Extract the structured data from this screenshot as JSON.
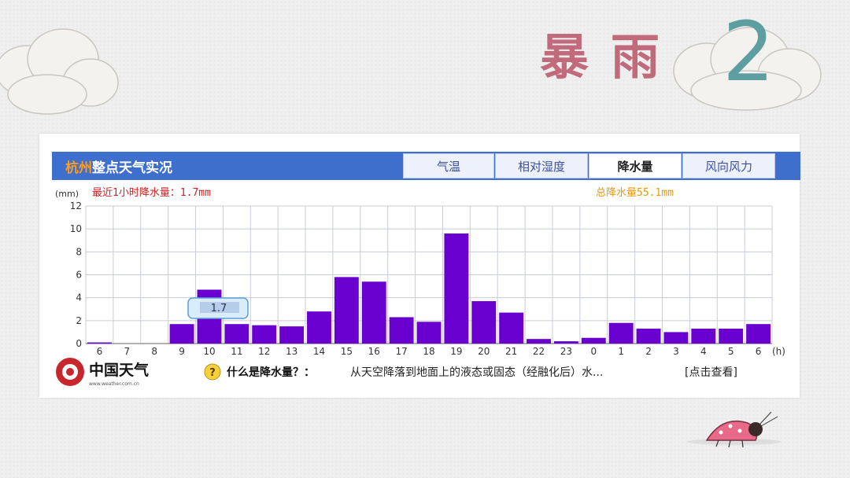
{
  "slide": {
    "title": "暴雨",
    "number": "2"
  },
  "widget": {
    "city": "杭州",
    "title_rest": "整点天气实况",
    "tabs": [
      {
        "label": "气温",
        "active": false
      },
      {
        "label": "相对湿度",
        "active": false
      },
      {
        "label": "降水量",
        "active": true
      },
      {
        "label": "风向风力",
        "active": false
      }
    ],
    "recent_precip_text": "最近1小时降水量：1.7mm",
    "total_precip_text": "总降水量55.1mm",
    "tooltip_value": "1.7",
    "logo_text": "中国天气",
    "logo_url_text": "www.weather.com.cn",
    "faq_question": "什么是降水量？：",
    "faq_answer": "从天空降落到地面上的液态或固态（经融化后）水...",
    "faq_link": "[点击查看]"
  },
  "colors": {
    "bar": "#6a00cf",
    "header": "#3e6fcd",
    "recent_text": "#d21f1f",
    "total_text": "#e39a14",
    "title": "#c06a7c",
    "number": "#5d9ea0"
  },
  "chart_data": {
    "type": "bar",
    "ylabel": "(mm)",
    "xunit": "(h)",
    "categories": [
      "6",
      "7",
      "8",
      "9",
      "10",
      "11",
      "12",
      "13",
      "14",
      "15",
      "16",
      "17",
      "18",
      "19",
      "20",
      "21",
      "22",
      "23",
      "0",
      "1",
      "2",
      "3",
      "4",
      "5",
      "6"
    ],
    "values": [
      0.1,
      0,
      0,
      1.7,
      4.7,
      1.7,
      1.6,
      1.5,
      2.8,
      5.8,
      5.4,
      2.3,
      1.9,
      9.6,
      3.7,
      2.7,
      0.4,
      0.2,
      0.5,
      1.8,
      1.3,
      1.0,
      1.3,
      1.3,
      1.7
    ],
    "ylim": [
      0,
      12
    ],
    "yticks": [
      0,
      2,
      4,
      6,
      8,
      10,
      12
    ],
    "grid": true
  }
}
